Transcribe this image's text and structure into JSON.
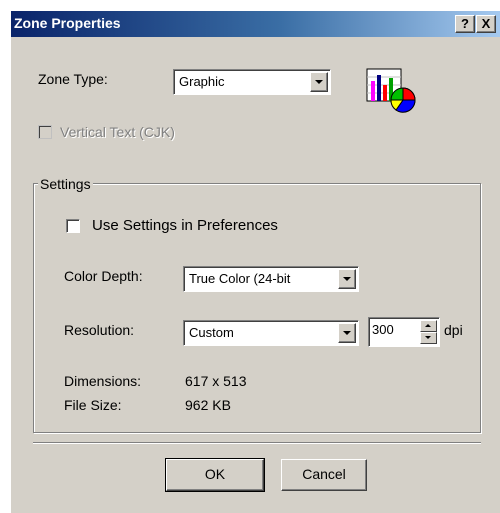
{
  "window": {
    "title": "Zone Properties",
    "help_button": "?",
    "close_button": "X"
  },
  "zone_type": {
    "label": "Zone Type:",
    "selected": "Graphic",
    "icon": "chart-graphic-icon"
  },
  "vertical_text": {
    "label": "Vertical Text (CJK)",
    "checked": false,
    "enabled": false
  },
  "settings": {
    "group_label": "Settings",
    "use_prefs_label": "Use Settings in Preferences",
    "use_prefs_checked": false,
    "color_depth_label": "Color Depth:",
    "color_depth_value": "True Color (24-bit",
    "resolution_label": "Resolution:",
    "resolution_value": "Custom",
    "dpi_value": "300",
    "dpi_unit": "dpi",
    "dimensions_label": "Dimensions:",
    "dimensions_value": "617 x 513",
    "file_size_label": "File Size:",
    "file_size_value": "962 KB"
  },
  "buttons": {
    "ok": "OK",
    "cancel": "Cancel"
  }
}
